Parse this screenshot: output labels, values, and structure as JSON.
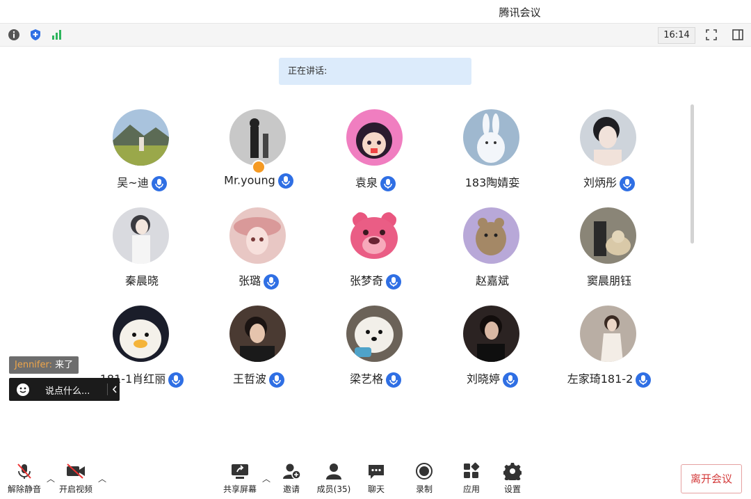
{
  "window": {
    "title": "腾讯会议"
  },
  "top_toolbar": {
    "clock": "16:14"
  },
  "speaking": {
    "label": "正在讲话:"
  },
  "participants": [
    {
      "name": "吴~迪",
      "mic": true
    },
    {
      "name": "Mr.young",
      "mic": true,
      "host": true
    },
    {
      "name": "袁泉",
      "mic": true
    },
    {
      "name": "183陶婧娈",
      "mic": false
    },
    {
      "name": "刘炳彤",
      "mic": true
    },
    {
      "name": "秦晨晓",
      "mic": false
    },
    {
      "name": "张璐",
      "mic": true
    },
    {
      "name": "张梦奇",
      "mic": true
    },
    {
      "name": "赵嘉斌",
      "mic": false
    },
    {
      "name": "窦晨朋钰",
      "mic": false
    },
    {
      "name": "181-1肖红丽",
      "mic": true
    },
    {
      "name": "王哲波",
      "mic": true
    },
    {
      "name": "梁艺格",
      "mic": true
    },
    {
      "name": "刘晓婷",
      "mic": true
    },
    {
      "name": "左家琦181-2",
      "mic": true
    }
  ],
  "chat": {
    "toast_user": "Jennifer:",
    "toast_msg": "来了",
    "input_placeholder": "说点什么..."
  },
  "bottom_bar": {
    "unmute": "解除静音",
    "video": "开启视频",
    "share": "共享屏幕",
    "invite": "邀请",
    "members": "成员(35)",
    "chat": "聊天",
    "record": "录制",
    "apps": "应用",
    "settings": "设置",
    "leave": "离开会议"
  },
  "colors": {
    "accent": "#2f6fe4",
    "leave": "#d33a3a",
    "speaking_bg": "#dcebfb"
  }
}
